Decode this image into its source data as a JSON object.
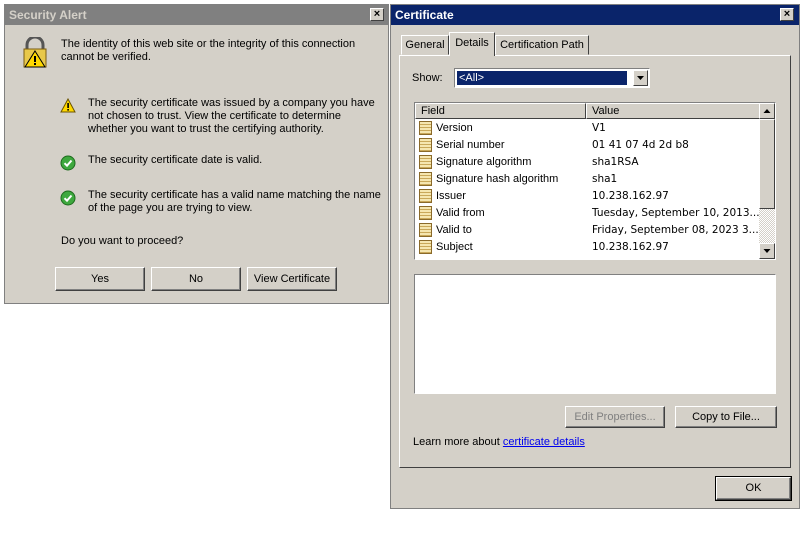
{
  "security_alert": {
    "title": "Security Alert",
    "close_label": "×",
    "intro": "The identity of this web site or the integrity of this connection cannot be verified.",
    "items": [
      {
        "icon": "warning-icon",
        "text": "The security certificate was issued by a company you have not chosen to trust. View the certificate to determine whether you want to trust the certifying authority."
      },
      {
        "icon": "check-icon",
        "text": "The security certificate date is valid."
      },
      {
        "icon": "check-icon",
        "text": "The security certificate has a valid name matching the name of the page you are trying to view."
      }
    ],
    "question": "Do you want to proceed?",
    "buttons": {
      "yes": "Yes",
      "no": "No",
      "view": "View Certificate"
    }
  },
  "certificate": {
    "title": "Certificate",
    "close_label": "×",
    "tabs": [
      "General",
      "Details",
      "Certification Path"
    ],
    "active_tab": "Details",
    "show_label": "Show:",
    "show_value": "<All>",
    "columns": {
      "field": "Field",
      "value": "Value"
    },
    "rows": [
      {
        "field": "Version",
        "value": "V1"
      },
      {
        "field": "Serial number",
        "value": "01 41 07 4d 2d b8"
      },
      {
        "field": "Signature algorithm",
        "value": "sha1RSA"
      },
      {
        "field": "Signature hash algorithm",
        "value": "sha1"
      },
      {
        "field": "Issuer",
        "value": "10.238.162.97"
      },
      {
        "field": "Valid from",
        "value": "Tuesday, September 10, 2013..."
      },
      {
        "field": "Valid to",
        "value": "Friday, September 08, 2023 3..."
      },
      {
        "field": "Subject",
        "value": "10.238.162.97"
      }
    ],
    "edit_properties": "Edit Properties...",
    "copy_to_file": "Copy to File...",
    "learn_more_prefix": "Learn more about",
    "learn_more_link": "certificate details",
    "ok": "OK"
  },
  "colors": {
    "titlebar_active": "#0a246a",
    "titlebar_inactive": "#808080",
    "selection": "#0a246a",
    "link": "#0000ee"
  }
}
